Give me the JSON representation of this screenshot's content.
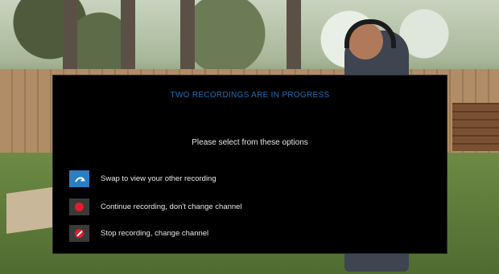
{
  "dialog": {
    "title": "TWO RECORDINGS ARE IN PROGRESS",
    "subtitle": "Please select from these options",
    "options": [
      {
        "label": "Swap to view your other recording",
        "icon": "swap-arrow-icon",
        "selected": true
      },
      {
        "label": "Continue recording, don't change channel",
        "icon": "record-dot-icon",
        "selected": false
      },
      {
        "label": "Stop recording, change channel",
        "icon": "stop-record-icon",
        "selected": false
      }
    ]
  },
  "colors": {
    "title": "#1f6fb0",
    "selected_highlight": "#2a7ec1",
    "record_red": "#e11d2a",
    "dialog_bg": "#000000"
  }
}
